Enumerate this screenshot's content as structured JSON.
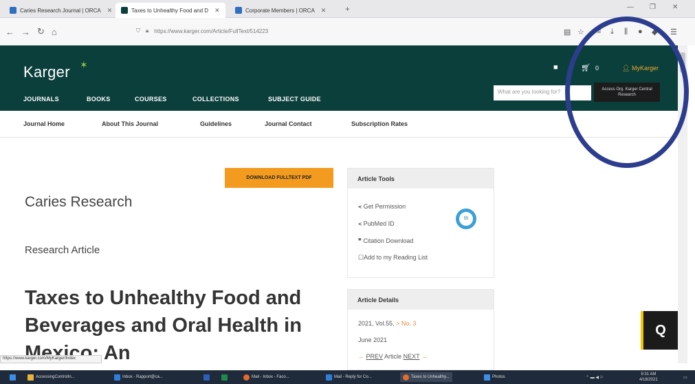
{
  "browser": {
    "tabs": [
      {
        "label": "Caries Research Journal | ORCA"
      },
      {
        "label": "Taxes to Unhealthy Food and D"
      },
      {
        "label": "Corporate Members | ORCA"
      }
    ],
    "url": "https://www.karger.com/Article/FullText/514223"
  },
  "header": {
    "logo": "Karger",
    "main_nav": [
      "JOURNALS",
      "BOOKS",
      "COURSES",
      "COLLECTIONS",
      "SUBJECT GUIDE"
    ],
    "cart_count": "0",
    "my_karger": "MyKarger",
    "search_placeholder": "What are you looking for?",
    "access_button": "Access Org. Karger Central Research"
  },
  "subnav": [
    "Journal Home",
    "About This Journal",
    "Guidelines",
    "Journal Contact",
    "Subscription Rates"
  ],
  "article": {
    "download_label": "DOWNLOAD FULLTEXT PDF",
    "journal": "Caries Research",
    "type": "Research Article",
    "headline": "Taxes to Unhealthy Food and Beverages and Oral Health in Mexico: An"
  },
  "tools": {
    "title": "Article Tools",
    "items": [
      "Get Permission",
      "PubMed ID",
      "Citation Download",
      "Add to my Reading List"
    ],
    "altmetric": "55"
  },
  "details": {
    "title": "Article Details",
    "volume": "2021, Vol.55,",
    "issue": "> No. 3",
    "date": "June 2021",
    "prev": "PREV",
    "article_word": "Article",
    "next": "NEXT"
  },
  "q_button": "Q",
  "status_url": "https://www.karger.com/MyKarger/Index",
  "taskbar": {
    "apps": [
      "AccessingControlIn...",
      "Inbox - Rapport@ca...",
      "Mail - Inbox - Faco...",
      "Mail - Reply for Co...",
      "Taxes to Unhealthy...",
      "Photos"
    ],
    "time": "9:31 AM",
    "date": "4/18/2021"
  },
  "colors": {
    "header": "#0b3f3c",
    "accent": "#f29b1f",
    "annotation": "#2c3d8f"
  }
}
